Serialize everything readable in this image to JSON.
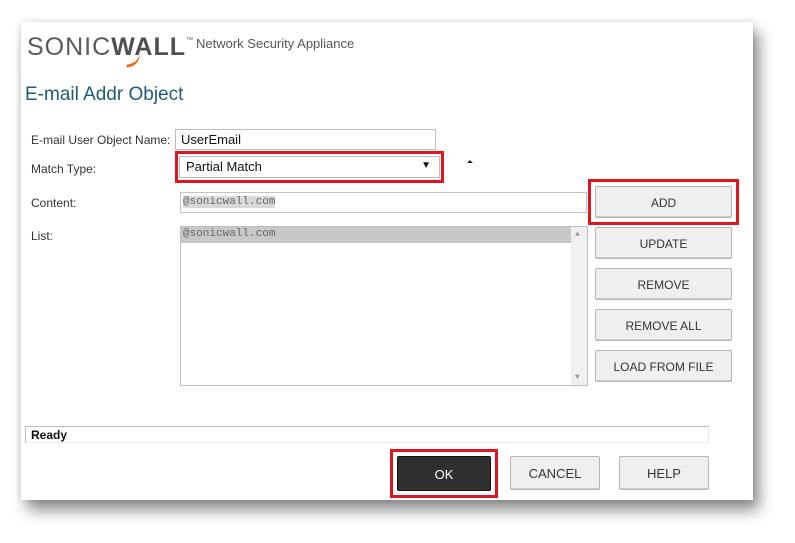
{
  "header": {
    "brand_light": "SONIC",
    "brand_bold": "WALL",
    "brand_tm": "™",
    "subtitle": "Network Security Appliance"
  },
  "page_title": "E-mail Addr Object",
  "form": {
    "name_label": "E-mail User Object Name:",
    "name_value": "UserEmail",
    "match_type_label": "Match Type:",
    "match_type_value": "Partial Match",
    "match_type_arrow": "▼",
    "content_label": "Content:",
    "content_value": "@sonicwall.com",
    "list_label": "List:",
    "list_items": [
      "@sonicwall.com"
    ]
  },
  "side_buttons": {
    "add": "ADD",
    "update": "UPDATE",
    "remove": "REMOVE",
    "remove_all": "REMOVE ALL",
    "load_from_file": "LOAD FROM FILE"
  },
  "status_text": "Ready",
  "footer_buttons": {
    "ok": "OK",
    "cancel": "CANCEL",
    "help": "HELP"
  },
  "colors": {
    "highlight": "#e0151f",
    "title": "#1d5b7a",
    "brand_accent": "#f26b21"
  }
}
